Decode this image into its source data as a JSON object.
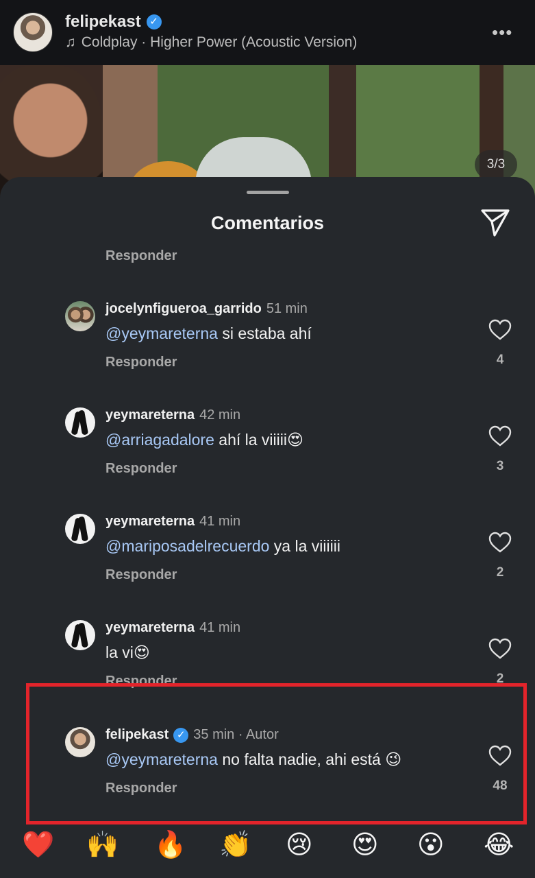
{
  "post": {
    "username": "felipekast",
    "music": "Coldplay · Higher Power (Acoustic Version)",
    "more": "•••",
    "pager": "3/3"
  },
  "sheet": {
    "title": "Comentarios",
    "top_reply": "Responder"
  },
  "comments": [
    {
      "username": "jocelynfigueroa_garrido",
      "time": "51 min",
      "mention": "@yeymareterna",
      "text": " si estaba ahí",
      "reply": "Responder",
      "likes": "4"
    },
    {
      "username": "yeymareterna",
      "time": "42 min",
      "mention": "@arriagadalore",
      "text": " ahí la viiiii😍",
      "reply": "Responder",
      "likes": "3"
    },
    {
      "username": "yeymareterna",
      "time": "41 min",
      "mention": "@mariposadelrecuerdo",
      "text": " ya la viiiiii",
      "reply": "Responder",
      "likes": "2"
    },
    {
      "username": "yeymareterna",
      "time": "41 min",
      "mention": "",
      "text": "la vi😍",
      "reply": "Responder",
      "likes": "2"
    },
    {
      "username": "felipekast",
      "time": "35 min · Autor",
      "mention": "@yeymareterna",
      "text": " no falta nadie, ahi está 😉",
      "reply": "Responder",
      "likes": "48"
    }
  ],
  "emojis": [
    "❤️",
    "🙌",
    "🔥",
    "👏",
    "😢",
    "😍",
    "😮",
    "😂"
  ],
  "colors": {
    "accent": "#3897f0",
    "mention": "#a8c8f5",
    "highlight": "#e3242b"
  }
}
